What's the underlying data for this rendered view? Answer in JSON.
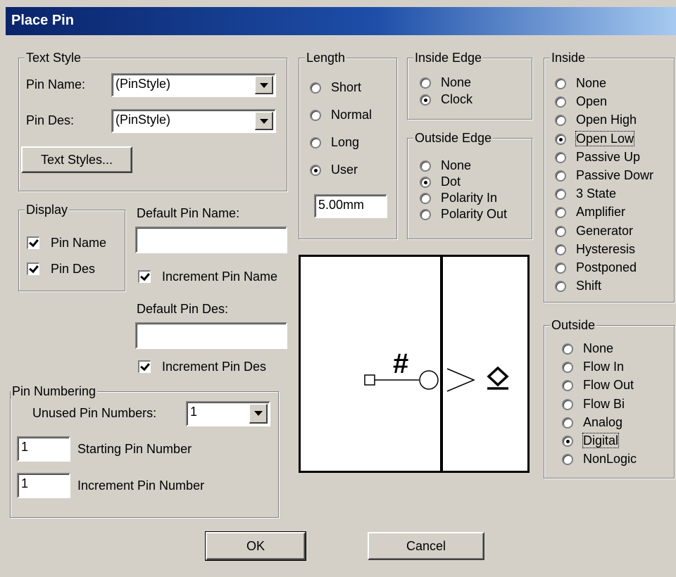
{
  "dialog": {
    "title": "Place Pin"
  },
  "text_style": {
    "legend": "Text Style",
    "pin_name_label": "Pin Name:",
    "pin_name_value": "(PinStyle)",
    "pin_des_label": "Pin Des:",
    "pin_des_value": "(PinStyle)",
    "text_styles_button": "Text Styles..."
  },
  "display": {
    "legend": "Display",
    "pin_name_label": "Pin Name",
    "pin_name_checked": true,
    "pin_des_label": "Pin Des",
    "pin_des_checked": true
  },
  "defaults": {
    "default_pin_name_label": "Default Pin Name:",
    "default_pin_name_value": "",
    "increment_pin_name_label": "Increment Pin Name",
    "increment_pin_name_checked": true,
    "default_pin_des_label": "Default Pin Des:",
    "default_pin_des_value": "",
    "increment_pin_des_label": "Increment Pin Des",
    "increment_pin_des_checked": true
  },
  "pin_numbering": {
    "legend": "Pin Numbering",
    "unused_label": "Unused Pin Numbers:",
    "unused_value": "1",
    "starting_value": "1",
    "starting_label": "Starting Pin Number",
    "increment_value": "1",
    "increment_label": "Increment Pin Number"
  },
  "length": {
    "legend": "Length",
    "options": [
      "Short",
      "Normal",
      "Long",
      "User"
    ],
    "selected": "User",
    "user_value": "5.00mm"
  },
  "inside_edge": {
    "legend": "Inside Edge",
    "options": [
      "None",
      "Clock"
    ],
    "selected": "Clock"
  },
  "outside_edge": {
    "legend": "Outside Edge",
    "options": [
      "None",
      "Dot",
      "Polarity In",
      "Polarity Out"
    ],
    "selected": "Dot"
  },
  "inside": {
    "legend": "Inside",
    "options": [
      "None",
      "Open",
      "Open High",
      "Open Low",
      "Passive Up",
      "Passive Dowr",
      "3 State",
      "Amplifier",
      "Generator",
      "Hysteresis",
      "Postponed",
      "Shift"
    ],
    "selected": "Open Low"
  },
  "outside": {
    "legend": "Outside",
    "options": [
      "None",
      "Flow In",
      "Flow Out",
      "Flow Bi",
      "Analog",
      "Digital",
      "NonLogic"
    ],
    "selected": "Digital"
  },
  "preview": {
    "pin_symbol": "#"
  },
  "buttons": {
    "ok": "OK",
    "cancel": "Cancel"
  },
  "colors": {
    "titlebar_start": "#0a246a",
    "titlebar_end": "#a6caf0",
    "face": "#d4d0c8"
  }
}
